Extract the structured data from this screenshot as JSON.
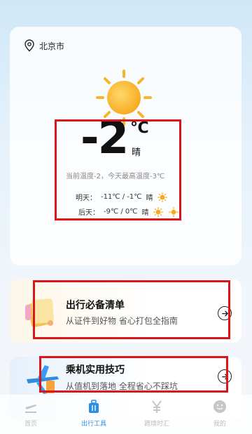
{
  "location": {
    "city": "北京市"
  },
  "weather": {
    "temperature": "-2",
    "unit": "℃",
    "condition": "晴",
    "description": "当前温度-2，今天最高温度-3℃"
  },
  "forecast": [
    {
      "label": "明天：",
      "range": "-11℃ / -1℃",
      "condition": "晴"
    },
    {
      "label": "后天：",
      "range": "-9℃ / 0℃",
      "condition": "晴"
    }
  ],
  "cards": [
    {
      "title": "出行必备清单",
      "subtitle": "从证件到好物 省心打包全指南"
    },
    {
      "title": "乘机实用技巧",
      "subtitle": "从值机到落地 全程省心不踩坑"
    }
  ],
  "nav": [
    {
      "label": "首页",
      "icon": "plane-land-icon"
    },
    {
      "label": "出行工具",
      "icon": "suitcase-icon"
    },
    {
      "label": "跨境时汇",
      "icon": "yen-icon"
    },
    {
      "label": "我的",
      "icon": "smiley-icon"
    }
  ],
  "colors": {
    "accent": "#2b8fe6",
    "sun": "#f7a81b",
    "highlight": "#d8161c"
  }
}
